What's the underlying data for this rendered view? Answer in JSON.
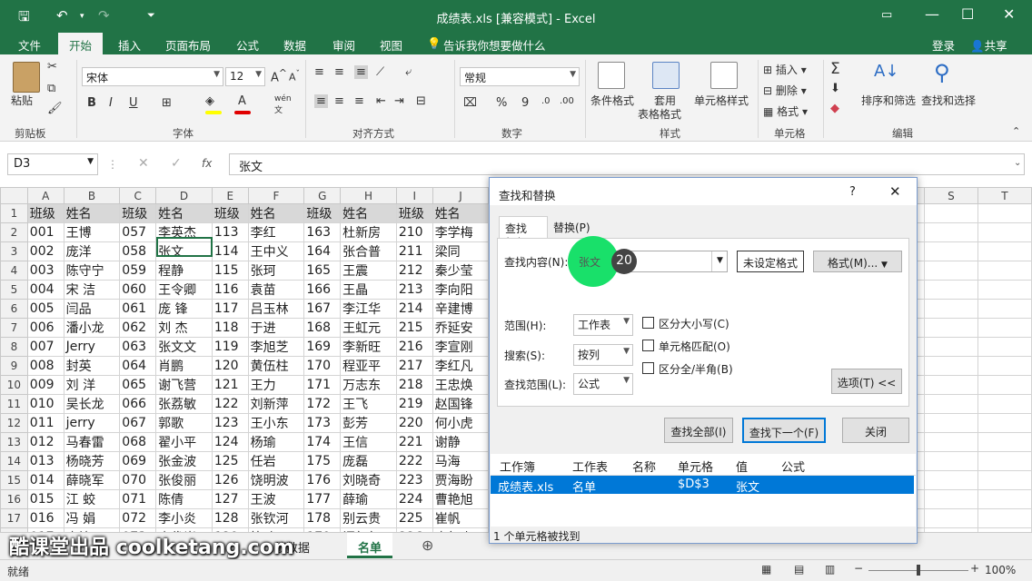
{
  "title": "成绩表.xls  [兼容模式] - Excel",
  "tabs": [
    "文件",
    "开始",
    "插入",
    "页面布局",
    "公式",
    "数据",
    "审阅",
    "视图"
  ],
  "tell_me": "告诉我你想要做什么",
  "login": "登录",
  "share": "共享",
  "ribbon": {
    "paste": "粘贴",
    "clipboard": "剪贴板",
    "font_name": "宋体",
    "font_size": "12",
    "font_group": "字体",
    "align_group": "对齐方式",
    "number_format": "常规",
    "number_group": "数字",
    "cond_format": "条件格式",
    "table_format_1": "套用",
    "table_format_2": "表格格式",
    "cell_style": "单元格样式",
    "style_group": "样式",
    "insert": "插入",
    "delete": "删除",
    "format": "格式",
    "cells_group": "单元格",
    "sort_filter": "排序和筛选",
    "find_select": "查找和选择",
    "edit_group": "编辑",
    "bold": "B",
    "italic": "I",
    "underline": "U",
    "percent": "%",
    "comma": "9"
  },
  "formula_bar": {
    "name_box": "D3",
    "fx": "fx",
    "value": "张文"
  },
  "columns": [
    "A",
    "B",
    "C",
    "D",
    "E",
    "F",
    "G",
    "H",
    "I",
    "J",
    "S",
    "T"
  ],
  "rows": [
    [
      "班级",
      "姓名",
      "班级",
      "姓名",
      "班级",
      "姓名",
      "班级",
      "姓名",
      "班级",
      "姓名"
    ],
    [
      "001",
      "王博",
      "057",
      "李英杰",
      "113",
      "李红",
      "163",
      "杜新房",
      "210",
      "李学梅"
    ],
    [
      "002",
      "庞洋",
      "058",
      "张文",
      "114",
      "王中义",
      "164",
      "张合普",
      "211",
      "梁同"
    ],
    [
      "003",
      "陈守宁",
      "059",
      "程静",
      "115",
      "张珂",
      "165",
      "王震",
      "212",
      "秦少莹"
    ],
    [
      "004",
      "宋  洁",
      "060",
      "王令卿",
      "116",
      "袁苗",
      "166",
      "王晶",
      "213",
      "李向阳"
    ],
    [
      "005",
      "闫品",
      "061",
      "庞  锋",
      "117",
      "吕玉林",
      "167",
      "李江华",
      "214",
      "辛建博"
    ],
    [
      "006",
      "潘小龙",
      "062",
      "刘  杰",
      "118",
      "于进",
      "168",
      "王虹元",
      "215",
      "乔延安"
    ],
    [
      "007",
      "Jerry",
      "063",
      "张文文",
      "119",
      "李旭芝",
      "169",
      "李新旺",
      "216",
      "李宣刚"
    ],
    [
      "008",
      "封英",
      "064",
      "肖鹏",
      "120",
      "黄伍柱",
      "170",
      "程亚平",
      "217",
      "李红凡"
    ],
    [
      "009",
      "刘  洋",
      "065",
      "谢飞营",
      "121",
      "王力",
      "171",
      "万志东",
      "218",
      "王忠焕"
    ],
    [
      "010",
      "吴长龙",
      "066",
      "张荔敏",
      "122",
      "刘新萍",
      "172",
      "王飞",
      "219",
      "赵国锋"
    ],
    [
      "011",
      "jerry",
      "067",
      "郭歌",
      "123",
      "王小东",
      "173",
      "彭芳",
      "220",
      "何小虎"
    ],
    [
      "012",
      "马春雷",
      "068",
      "翟小平",
      "124",
      "杨瑜",
      "174",
      "王信",
      "221",
      "谢静"
    ],
    [
      "013",
      "杨晓芳",
      "069",
      "张金波",
      "125",
      "任岩",
      "175",
      "庞磊",
      "222",
      "马海"
    ],
    [
      "014",
      "薛晓军",
      "070",
      "张俊丽",
      "126",
      "饶明波",
      "176",
      "刘晓奇",
      "223",
      "贾海盼"
    ],
    [
      "015",
      "江  蛟",
      "071",
      "陈倩",
      "127",
      "王波",
      "177",
      "薛瑜",
      "224",
      "曹艳旭"
    ],
    [
      "016",
      "冯  娟",
      "072",
      "李小炎",
      "128",
      "张钦河",
      "178",
      "别云贵",
      "225",
      "崔帆"
    ],
    [
      "017",
      "袁锋",
      "073",
      "袁俊岩",
      "129",
      "符琰",
      "179",
      "闻红红",
      "226",
      "李红克"
    ]
  ],
  "sheet_tabs": {
    "tab1": "绩数据",
    "active": "名单"
  },
  "watermark": "酷课堂出品 coolketang.com",
  "status": {
    "ready": "就绪",
    "zoom": "100%"
  },
  "dialog": {
    "title": "查找和替换",
    "help": "?",
    "close": "✕",
    "tab_find": "查找(D)",
    "tab_replace": "替换(P)",
    "find_label": "查找内容(N):",
    "find_value": "张文",
    "badge": "20",
    "no_format": "未设定格式",
    "format_btn": "格式(M)...",
    "within_label": "范围(H):",
    "within_value": "工作表",
    "search_label": "搜索(S):",
    "search_value": "按列",
    "lookin_label": "查找范围(L):",
    "lookin_value": "公式",
    "match_case": "区分大小写(C)",
    "match_cell": "单元格匹配(O)",
    "match_byte": "区分全/半角(B)",
    "options_btn": "选项(T) <<",
    "find_all": "查找全部(I)",
    "find_next": "查找下一个(F)",
    "close_btn": "关闭",
    "result_headers": [
      "工作簿",
      "工作表",
      "名称",
      "单元格",
      "值",
      "公式"
    ],
    "result_row": [
      "成绩表.xls",
      "名单",
      "",
      "$D$3",
      "张文",
      ""
    ],
    "status": "1 个单元格被找到"
  },
  "colors": {
    "excel_green": "#217346",
    "highlight_circle": "#19e06a",
    "badge": "#444444",
    "selection": "#0078d7"
  }
}
